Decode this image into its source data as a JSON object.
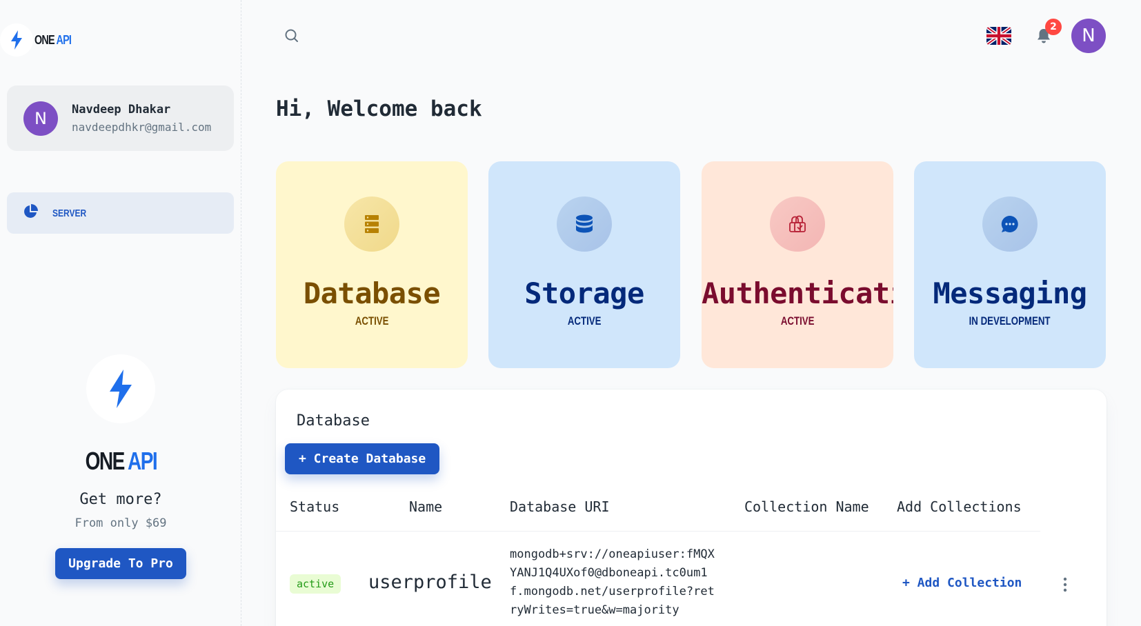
{
  "brand": {
    "one": "ONE",
    "api": "API"
  },
  "account": {
    "initial": "N",
    "name": "Navdeep Dhakar",
    "email": "navdeepdhkr@gmail.com"
  },
  "nav": {
    "items": [
      {
        "label": "SERVER",
        "icon": "pie-chart-icon"
      }
    ]
  },
  "promo": {
    "title": "Get more?",
    "subtitle": "From only $69",
    "button": "Upgrade To Pro"
  },
  "header": {
    "avatar_initial": "N",
    "notification_count": "2",
    "language": "en-GB"
  },
  "welcome": "Hi, Welcome back",
  "cards": [
    {
      "title": "Database",
      "status": "ACTIVE",
      "icon": "server-icon"
    },
    {
      "title": "Storage",
      "status": "ACTIVE",
      "icon": "database-icon"
    },
    {
      "title": "Authentication",
      "status": "ACTIVE",
      "icon": "lock-icon"
    },
    {
      "title": "Messaging",
      "status": "IN DEVELOPMENT",
      "icon": "chat-icon"
    }
  ],
  "database_panel": {
    "title": "Database",
    "create_button": "+ Create Database",
    "columns": [
      "Status",
      "Name",
      "Database URI",
      "Collection Name",
      "Add Collections"
    ],
    "rows": [
      {
        "status": "active",
        "name": "userprofile",
        "uri": "mongodb+srv://oneapiuser:fMQXYANJ1Q4UXof0@dboneapi.tc0um1f.mongodb.net/userprofile?retryWrites=true&w=majority",
        "collection_name": "",
        "add_collection": "+ Add Collection"
      }
    ]
  },
  "colors": {
    "primary": "#1f57c3",
    "accent_blue": "#1f6feb",
    "avatar": "#7d4fc4",
    "badge": "#ff4842",
    "status_active_bg": "#e9fcd4",
    "status_active_text": "#229a16"
  }
}
